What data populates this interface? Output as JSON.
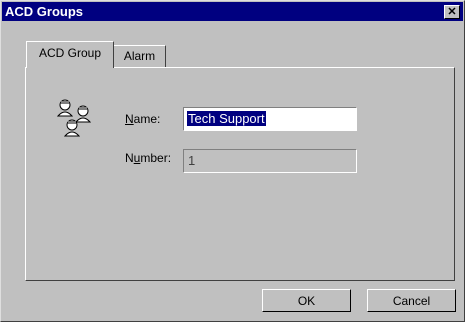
{
  "window": {
    "title": "ACD Groups",
    "close_glyph": "✕"
  },
  "tabs": [
    {
      "label": "ACD Group",
      "active": true
    },
    {
      "label": "Alarm",
      "active": false
    }
  ],
  "form": {
    "icon": "agents-group-icon",
    "name_label_prefix": "N",
    "name_label_rest": "ame:",
    "name_value": "Tech Support",
    "number_label_prefix": "N",
    "number_label_u": "u",
    "number_label_rest": "mber:",
    "number_value": "1"
  },
  "buttons": {
    "ok": "OK",
    "cancel": "Cancel"
  },
  "colors": {
    "titlebar": "#000080",
    "face": "#c0c0c0",
    "selection": "#000080"
  }
}
